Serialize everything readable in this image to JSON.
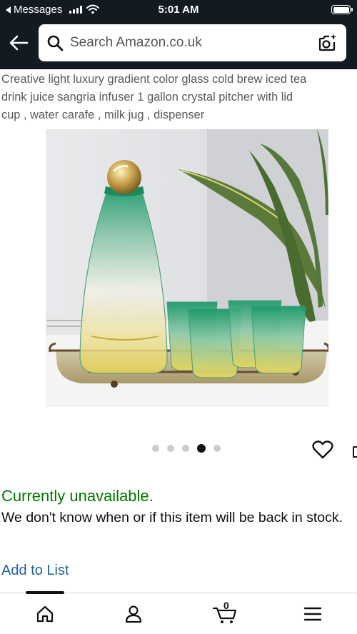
{
  "status_bar": {
    "back_app": "Messages",
    "time": "5:01 AM"
  },
  "header": {
    "search": {
      "placeholder": "Search Amazon.co.uk"
    },
    "icons": [
      "back-arrow-icon",
      "search-icon",
      "camera-search-icon"
    ]
  },
  "product": {
    "title_lines": [
      "Creative light luxury gradient color glass cold brew iced tea",
      "drink juice sangria infuser 1 gallon crystal pitcher with lid",
      "cup , water carafe , milk jug , dispenser"
    ],
    "image_alt": "Green-to-amber gradient glass carafe with gold ball stopper and four matching cups on a mirrored tray",
    "carousel": {
      "total": 5,
      "active_index": 3
    },
    "availability": "Currently unavailable.",
    "stock_message": "We don't know when or if this item will be back in stock.",
    "add_to_list": "Add to List"
  },
  "bottom_nav": {
    "items": [
      "home-icon",
      "account-icon",
      "cart-icon",
      "menu-icon"
    ],
    "cart_count": "0",
    "active": "home"
  },
  "colors": {
    "header_bg": "#131a22",
    "availability_green": "#007600",
    "link_blue": "#2162a1",
    "title_gray": "#565959"
  }
}
